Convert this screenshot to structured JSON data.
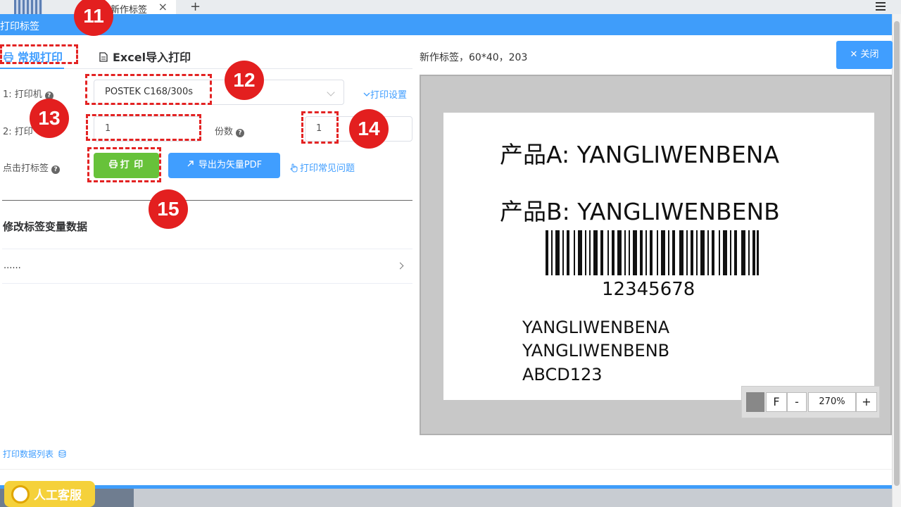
{
  "browser": {
    "tab_label": "新作标签",
    "tab_close": "×",
    "tab_add": "+"
  },
  "dialog": {
    "title": "打印标签"
  },
  "mode_tabs": {
    "normal": "常规打印",
    "excel": "Excel导入打印"
  },
  "form": {
    "printer_label": "1: 打印机",
    "printer_value": "POSTEK C168/300s",
    "print_settings_link": "打印设置",
    "range_label": "2: 打印",
    "range_value": "1",
    "copies_label": "份数",
    "copies_value": "1",
    "click_label": "点击打标签",
    "print_button": "打 印",
    "export_pdf_button": "导出为矢量PDF",
    "faq_link": "打印常见问题"
  },
  "variables": {
    "section_title": "修改标签变量数据",
    "row_text": "......"
  },
  "preview": {
    "label_info": "新作标签，60*40，203",
    "close_button": "关闭",
    "line1": "产品A:  YANGLIWENBENA",
    "line2": "产品B:  YANGLIWENBENB",
    "barcode_number": "12345678",
    "text1": "YANGLIWENBENA",
    "text2": "YANGLIWENBENB",
    "text3": "ABCD123",
    "zoom_f": "F",
    "zoom_minus": "-",
    "zoom_value": "270%",
    "zoom_plus": "+"
  },
  "footer": {
    "data_list_link": "打印数据列表",
    "customer_service": "人工客服"
  },
  "annotations": {
    "m11": "11",
    "m12": "12",
    "m13": "13",
    "m14": "14",
    "m15": "15"
  },
  "colors": {
    "header_blue": "#3f9dfa",
    "primary": "#409eff",
    "success": "#67c23a",
    "annotation_red": "#e31f1f"
  }
}
